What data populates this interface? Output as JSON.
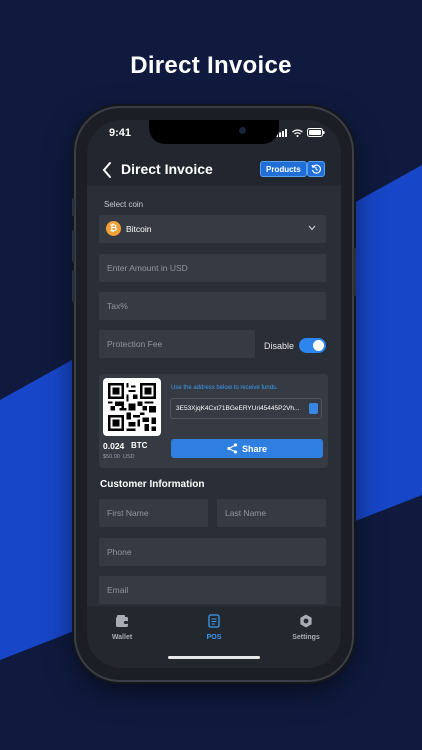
{
  "hero": {
    "title": "Direct Invoice"
  },
  "status": {
    "time": "9:41"
  },
  "header": {
    "title": "Direct Invoice",
    "products_label": "Products"
  },
  "form": {
    "select_coin_label": "Select coin",
    "coin": {
      "symbol": "₿",
      "name": "Bitcoin"
    },
    "amount_placeholder": "Enter Amount in USD",
    "tax_placeholder": "Tax%",
    "fee_placeholder": "Protection Fee",
    "disable_label": "Disable",
    "disable_on": true
  },
  "qr": {
    "btc_amount": "0.024",
    "btc_unit": "BTC",
    "usd_amount": "$50.00",
    "usd_unit": "USD",
    "address_hint": "Use the address below to receive funds.",
    "address": "3E53XjqK4Cxt71BGeERYUri45445P2Vh...",
    "share_label": "Share"
  },
  "customer": {
    "title": "Customer Information",
    "first_name_placeholder": "First Name",
    "last_name_placeholder": "Last Name",
    "phone_placeholder": "Phone",
    "email_placeholder": "Email"
  },
  "tabs": [
    {
      "label": "Wallet",
      "icon": "wallet-icon"
    },
    {
      "label": "POS",
      "icon": "pos-icon"
    },
    {
      "label": "Settings",
      "icon": "gear-icon"
    }
  ],
  "colors": {
    "background": "#0f1a3e",
    "accent": "#2f7fe0",
    "stripe": "#1746c8",
    "bitcoin": "#f2a036"
  }
}
